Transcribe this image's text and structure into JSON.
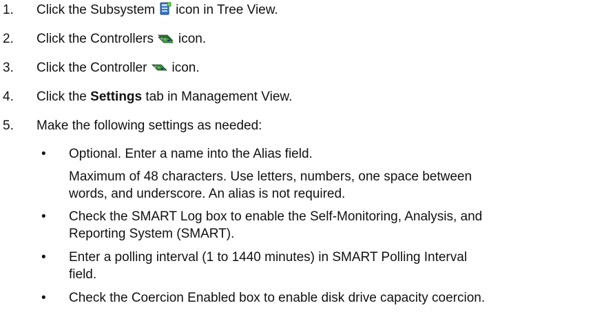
{
  "steps": [
    {
      "num": "1.",
      "pre": "Click the Subsystem",
      "icon": "subsystem-icon",
      "post": "icon in Tree View."
    },
    {
      "num": "2.",
      "pre": "Click the Controllers",
      "icon": "controllers-icon",
      "post": "icon."
    },
    {
      "num": "3.",
      "pre": "Click the Controller",
      "icon": "controller-icon",
      "post": "icon."
    },
    {
      "num": "4.",
      "pre": "Click the ",
      "bold": "Settings",
      "post": " tab in Management View."
    },
    {
      "num": "5.",
      "text": "Make the following settings as needed:"
    }
  ],
  "bullets": [
    {
      "mark": "•",
      "lines": [
        "Optional. Enter a name into the Alias field."
      ]
    },
    {
      "mark": "",
      "lines": [
        "Maximum of 48 characters. Use letters, numbers, one space between",
        "words, and underscore. An alias is not required."
      ]
    },
    {
      "mark": "•",
      "lines": [
        "Check the SMART Log box to enable the Self-Monitoring, Analysis, and",
        "Reporting System (SMART)."
      ]
    },
    {
      "mark": "•",
      "lines": [
        "Enter a polling interval (1 to 1440 minutes) in SMART Polling Interval",
        "field."
      ]
    },
    {
      "mark": "•",
      "lines": [
        "Check the Coercion Enabled box to enable disk drive capacity coercion."
      ]
    }
  ]
}
